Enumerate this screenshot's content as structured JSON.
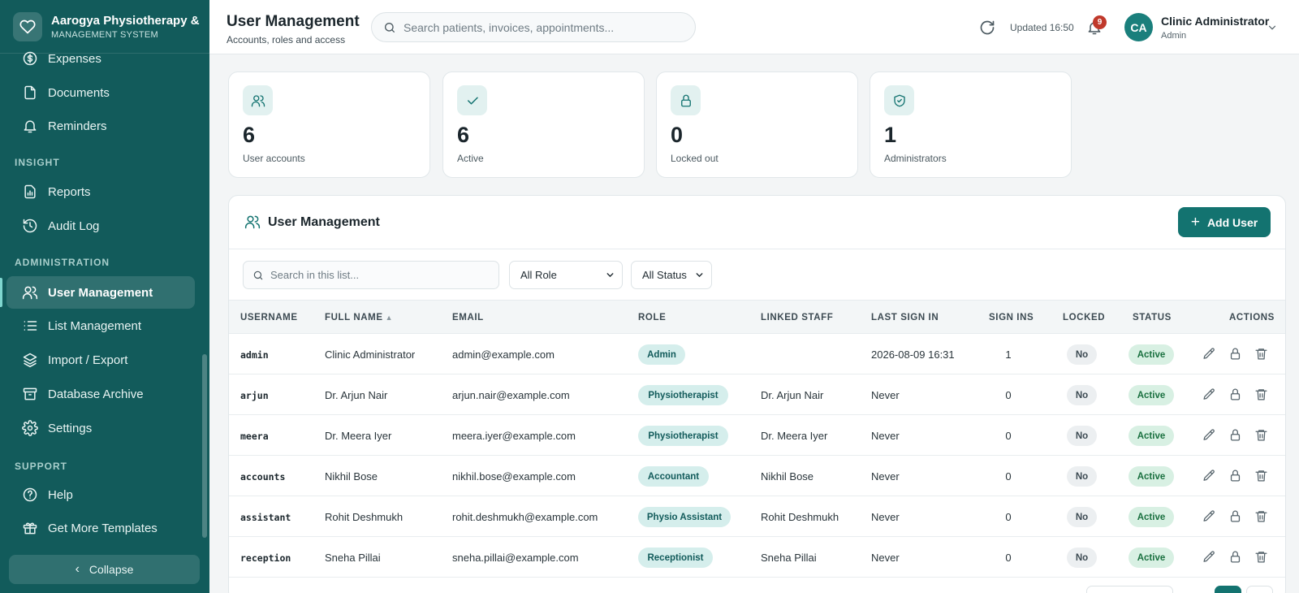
{
  "brand": {
    "title": "Aarogya Physiotherapy & Rehab",
    "subtitle": "MANAGEMENT SYSTEM"
  },
  "sidebar": {
    "top_items": [
      {
        "label": "Expenses",
        "icon": "dollar-icon"
      },
      {
        "label": "Documents",
        "icon": "document-icon"
      },
      {
        "label": "Reminders",
        "icon": "bell-icon"
      }
    ],
    "sections": [
      {
        "title": "INSIGHT",
        "items": [
          {
            "label": "Reports",
            "icon": "report-icon"
          },
          {
            "label": "Audit Log",
            "icon": "history-icon"
          }
        ]
      },
      {
        "title": "ADMINISTRATION",
        "items": [
          {
            "label": "User Management",
            "icon": "users-icon",
            "active": true
          },
          {
            "label": "List Management",
            "icon": "list-icon"
          },
          {
            "label": "Import / Export",
            "icon": "layers-icon"
          },
          {
            "label": "Database Archive",
            "icon": "archive-icon"
          },
          {
            "label": "Settings",
            "icon": "gear-icon"
          }
        ]
      },
      {
        "title": "SUPPORT",
        "items": [
          {
            "label": "Help",
            "icon": "help-icon"
          },
          {
            "label": "Get More Templates",
            "icon": "gift-icon"
          }
        ]
      }
    ],
    "collapse_label": "Collapse"
  },
  "header": {
    "title": "User Management",
    "subtitle": "Accounts, roles and access",
    "search_placeholder": "Search patients, invoices, appointments...",
    "updated": "Updated 16:50",
    "notifications": "9",
    "user": {
      "initials": "CA",
      "name": "Clinic Administrator",
      "role": "Admin"
    }
  },
  "stats": [
    {
      "value": "6",
      "label": "User accounts",
      "icon": "users-icon"
    },
    {
      "value": "6",
      "label": "Active",
      "icon": "check-icon"
    },
    {
      "value": "0",
      "label": "Locked out",
      "icon": "lock-icon"
    },
    {
      "value": "1",
      "label": "Administrators",
      "icon": "shield-check-icon"
    }
  ],
  "panel": {
    "title": "User Management",
    "add_button": "Add User",
    "search_placeholder": "Search in this list...",
    "role_filter": "All Role",
    "status_filter": "All Status",
    "columns": [
      "USERNAME",
      "FULL NAME",
      "EMAIL",
      "ROLE",
      "LINKED STAFF",
      "LAST SIGN IN",
      "SIGN INS",
      "LOCKED",
      "STATUS",
      "ACTIONS"
    ],
    "sort_indicator": "▲",
    "rows": [
      {
        "username": "admin",
        "full_name": "Clinic Administrator",
        "email": "admin@example.com",
        "role": "Admin",
        "linked_staff": "",
        "last_sign_in": "2026-08-09 16:31",
        "sign_ins": "1",
        "locked": "No",
        "status": "Active"
      },
      {
        "username": "arjun",
        "full_name": "Dr. Arjun Nair",
        "email": "arjun.nair@example.com",
        "role": "Physiotherapist",
        "linked_staff": "Dr. Arjun Nair",
        "last_sign_in": "Never",
        "sign_ins": "0",
        "locked": "No",
        "status": "Active"
      },
      {
        "username": "meera",
        "full_name": "Dr. Meera Iyer",
        "email": "meera.iyer@example.com",
        "role": "Physiotherapist",
        "linked_staff": "Dr. Meera Iyer",
        "last_sign_in": "Never",
        "sign_ins": "0",
        "locked": "No",
        "status": "Active"
      },
      {
        "username": "accounts",
        "full_name": "Nikhil Bose",
        "email": "nikhil.bose@example.com",
        "role": "Accountant",
        "linked_staff": "Nikhil Bose",
        "last_sign_in": "Never",
        "sign_ins": "0",
        "locked": "No",
        "status": "Active"
      },
      {
        "username": "assistant",
        "full_name": "Rohit Deshmukh",
        "email": "rohit.deshmukh@example.com",
        "role": "Physio Assistant",
        "linked_staff": "Rohit Deshmukh",
        "last_sign_in": "Never",
        "sign_ins": "0",
        "locked": "No",
        "status": "Active"
      },
      {
        "username": "reception",
        "full_name": "Sneha Pillai",
        "email": "sneha.pillai@example.com",
        "role": "Receptionist",
        "linked_staff": "Sneha Pillai",
        "last_sign_in": "Never",
        "sign_ins": "0",
        "locked": "No",
        "status": "Active"
      }
    ]
  },
  "colors": {
    "sidebar": "#125b5b",
    "accent": "#137370",
    "badge": "#c0392b",
    "active_status": "#19703f"
  }
}
